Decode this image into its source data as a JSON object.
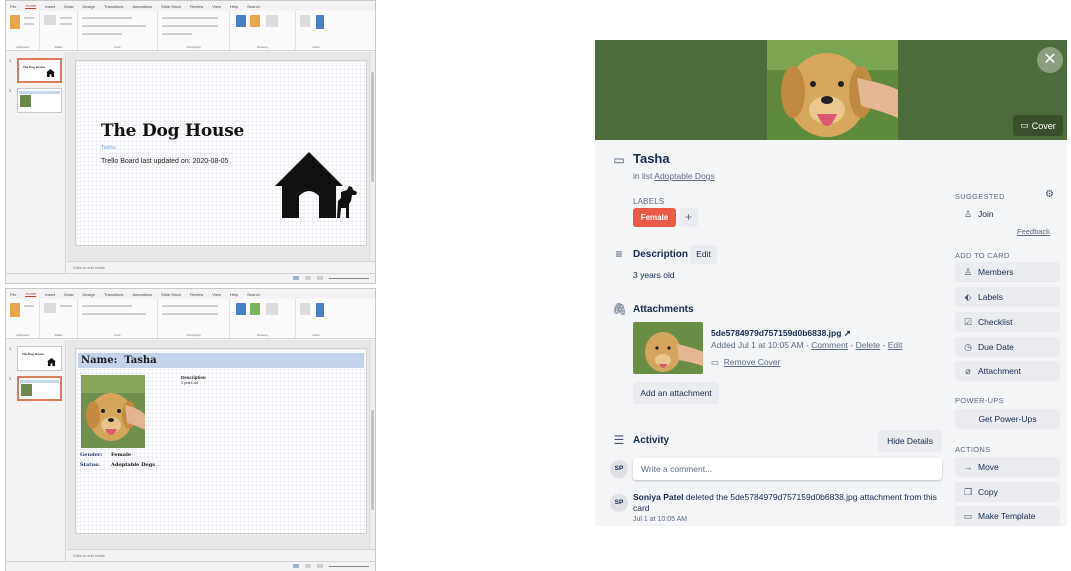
{
  "ppt_common": {
    "menu": [
      "File",
      "Home",
      "Insert",
      "Draw",
      "Design",
      "Transitions",
      "Animations",
      "Slide Show",
      "Review",
      "View",
      "Help",
      "Search"
    ],
    "active_menu": "Home",
    "groups": [
      "Clipboard",
      "Slides",
      "Font",
      "Paragraph",
      "Drawing",
      "Voice"
    ],
    "notes_placeholder": "Click to add notes"
  },
  "ppt1": {
    "slide_title": "The Dog House",
    "subtitle": "Tasha",
    "updated": "Trello Board last updated on: 2020-08-05"
  },
  "ppt2": {
    "name_label": "Name:",
    "name_value": "Tasha",
    "desc_heading": "Description",
    "desc_value": "3 years old",
    "gender_label": "Gender:",
    "gender_value": "Female",
    "status_label": "Status:",
    "status_value": "Adoptable Dogs"
  },
  "trello": {
    "cover_button": "Cover",
    "title": "Tasha",
    "in_list_prefix": "in list",
    "list_name": "Adoptable Dogs",
    "labels_heading": "LABELS",
    "label": "Female",
    "label_color": "#eb5a46",
    "description_heading": "Description",
    "edit": "Edit",
    "description": "3 years old",
    "attachments_heading": "Attachments",
    "attachment_name": "5de5784979d757159d0b6838.jpg",
    "attachment_added": "Added Jul 1 at 10:05 AM - ",
    "link_comment": "Comment",
    "link_delete": "Delete",
    "link_edit": "Edit",
    "remove_cover": "Remove Cover",
    "add_attachment": "Add an attachment",
    "activity_heading": "Activity",
    "hide_details": "Hide Details",
    "avatar_initials": "SP",
    "comment_placeholder": "Write a comment...",
    "activity_user": "Soniya Patel",
    "activity_text": " deleted the 5de5784979d757159d0b6838.jpg attachment from this card",
    "activity_time": "Jul 1 at 10:05 AM",
    "suggested": "SUGGESTED",
    "join": "Join",
    "feedback": "Feedback",
    "add_to_card": "ADD TO CARD",
    "members": "Members",
    "labels": "Labels",
    "checklist": "Checklist",
    "due_date": "Due Date",
    "attachment": "Attachment",
    "power_ups": "POWER-UPS",
    "get_power_ups": "Get Power-Ups",
    "actions": "ACTIONS",
    "move": "Move",
    "copy": "Copy",
    "make_template": "Make Template",
    "cover_color": "#4e6b3d"
  }
}
